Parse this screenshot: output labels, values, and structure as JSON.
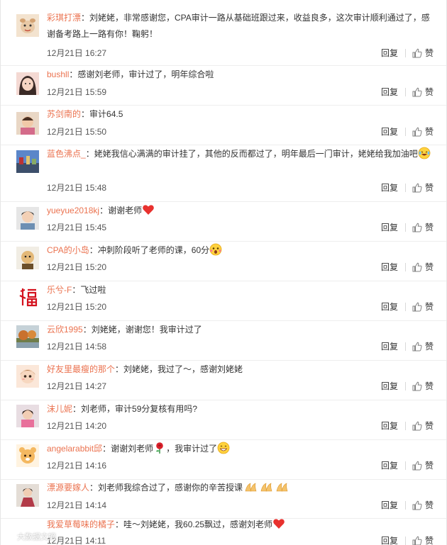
{
  "reply_label": "回复",
  "like_label": "赞",
  "watermark": "大数据文摘",
  "comments": [
    {
      "user": "彩琪打漂",
      "text": "：刘姥姥，非常感谢您，CPA审计一路从基础班跟过来，收益良多，这次审计顺利通过了，感谢备考路上一路有你！鞠躬！",
      "time": "12月21日 16:27",
      "emoji": ""
    },
    {
      "user": "bushll",
      "text": "：感谢刘老师，审计过了，明年综合啦",
      "time": "12月21日 15:59",
      "emoji": ""
    },
    {
      "user": "苏剑南的",
      "text": "：审计64.5",
      "time": "12月21日 15:50",
      "emoji": ""
    },
    {
      "user": "蓝色沸点_",
      "text": "：姥姥我信心满满的审计挂了，其他的反而都过了，明年最后一门审计，姥姥给我加油吧",
      "time": "12月21日 15:48",
      "emoji": "laughcry"
    },
    {
      "user": "yueyue2018kj",
      "text": "：谢谢老师",
      "time": "12月21日 15:45",
      "emoji": "heart"
    },
    {
      "user": "CPA的小岛",
      "text": "：冲刺阶段听了老师的课，60分",
      "time": "12月21日 15:20",
      "emoji": "shock"
    },
    {
      "user": "乐兮-F",
      "text": "：飞过啦",
      "time": "12月21日 15:20",
      "emoji": ""
    },
    {
      "user": "云欣1995",
      "text": "：刘姥姥，谢谢您！我审计过了",
      "time": "12月21日 14:58",
      "emoji": ""
    },
    {
      "user": "好友里最瘦的那个",
      "text": "：刘姥姥，我过了～，感谢刘姥姥",
      "time": "12月21日 14:27",
      "emoji": ""
    },
    {
      "user": "沫儿妮",
      "text": "：刘老师，审计59分复核有用吗?",
      "time": "12月21日 14:20",
      "emoji": ""
    },
    {
      "user": "angelarabbit邱",
      "text": "：谢谢刘老师",
      "text2": "，我审计过了",
      "time": "12月21日 14:16",
      "emoji": "rose"
    },
    {
      "user": "漂源要嫁人",
      "text": "：刘老师我综合过了，感谢你的辛苦授课",
      "time": "12月21日 14:14",
      "emoji": "pray"
    },
    {
      "user": "我爱草莓味的橘子",
      "text": "：哇～刘姥姥，我60.25飘过，感谢刘老师",
      "time": "12月21日 14:11",
      "emoji": "heart"
    }
  ]
}
